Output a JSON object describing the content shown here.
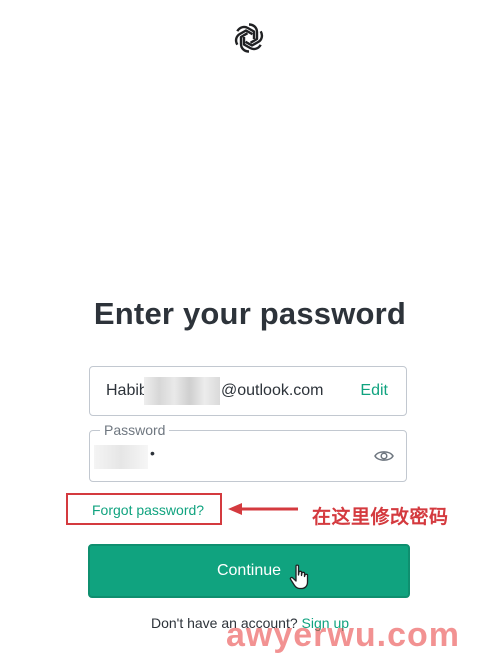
{
  "heading": "Enter your password",
  "email": {
    "prefix": "Habib",
    "domain": "@outlook.com",
    "edit_label": "Edit"
  },
  "password": {
    "label": "Password",
    "value": "•"
  },
  "forgot_label": "Forgot password?",
  "annotation": "在这里修改密码",
  "continue_label": "Continue",
  "signup": {
    "prompt": "Don't have an account?",
    "link_label": "Sign up"
  },
  "watermark": "awyerwu.com",
  "colors": {
    "accent": "#10a37f",
    "annotation": "#d43a3f",
    "text": "#2d333a"
  },
  "icons": {
    "logo": "openai-logo-icon",
    "eye": "eye-icon",
    "cursor": "hand-pointer-icon",
    "arrow": "red-arrow-icon"
  }
}
